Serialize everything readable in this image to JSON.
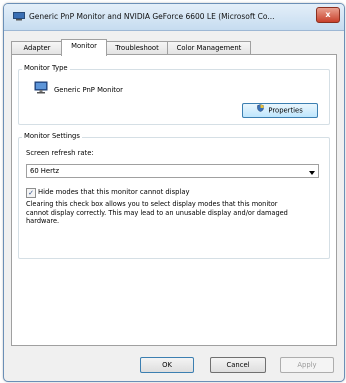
{
  "window": {
    "title": "Generic PnP Monitor and NVIDIA GeForce 6600 LE (Microsoft Co...",
    "close_label": "x"
  },
  "tabs": [
    {
      "label": "Adapter",
      "active": false
    },
    {
      "label": "Monitor",
      "active": true
    },
    {
      "label": "Troubleshoot",
      "active": false
    },
    {
      "label": "Color Management",
      "active": false
    }
  ],
  "monitor_type": {
    "group_label": "Monitor Type",
    "monitor_name": "Generic PnP Monitor",
    "properties_label": "Properties",
    "icon": "monitor-icon"
  },
  "monitor_settings": {
    "group_label": "Monitor Settings",
    "refresh_label": "Screen refresh rate:",
    "refresh_value": "60 Hertz",
    "hide_modes_label": "Hide modes that this monitor cannot display",
    "hide_modes_checked": true,
    "description": "Clearing this check box allows you to select display modes that this monitor cannot display correctly. This may lead to an unusable display and/or damaged hardware."
  },
  "footer": {
    "ok_label": "OK",
    "cancel_label": "Cancel",
    "apply_label": "Apply"
  },
  "colors": {
    "titlebar": "#c6dcf0",
    "close_button": "#c8412c",
    "focus_border": "#3c7fb1"
  }
}
